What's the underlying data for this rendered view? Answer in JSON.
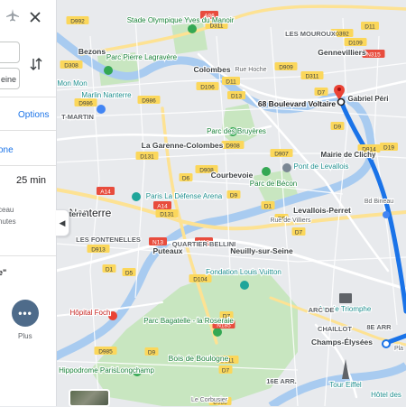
{
  "panel": {
    "origin_value": "",
    "destination_value": "eine",
    "options_label": "Options",
    "mode_label": "one",
    "duration": "25 min",
    "step_line1": "ceau",
    "step_line2": "nutes",
    "quote": "e\"",
    "more_label": "Plus"
  },
  "map": {
    "water": [
      "Seine"
    ],
    "places": [
      {
        "name": "Stade Olympique Yves du Manoir",
        "kind": "poi-green"
      },
      {
        "name": "Bezons",
        "kind": "city"
      },
      {
        "name": "Parc Pierre Lagravère",
        "kind": "poi-green"
      },
      {
        "name": "Colombes",
        "kind": "city"
      },
      {
        "name": "Rue Hoche",
        "kind": "street"
      },
      {
        "name": "LES MOUROUX",
        "kind": "district"
      },
      {
        "name": "Gennevilliers",
        "kind": "city"
      },
      {
        "name": "Gabriel Péri",
        "kind": "transit"
      },
      {
        "name": "68 Boulevard Voltaire",
        "kind": "pin"
      },
      {
        "name": "Nanterre",
        "kind": "city-large"
      },
      {
        "name": "Parc des Bruyères",
        "kind": "poi-green"
      },
      {
        "name": "La Garenne-Colombes",
        "kind": "city"
      },
      {
        "name": "Courbevoie",
        "kind": "city"
      },
      {
        "name": "Parc de Bécon",
        "kind": "poi-green"
      },
      {
        "name": "Pont de Levallois",
        "kind": "poi"
      },
      {
        "name": "Levallois-Perret",
        "kind": "city"
      },
      {
        "name": "Mairie de Clichy",
        "kind": "transit"
      },
      {
        "name": "Paris La Défense Arena",
        "kind": "poi"
      },
      {
        "name": "Nanterre",
        "kind": "city"
      },
      {
        "name": "LES FONTENELLES",
        "kind": "district"
      },
      {
        "name": "QUARTIER BELLINI",
        "kind": "district"
      },
      {
        "name": "Puteaux",
        "kind": "city"
      },
      {
        "name": "Neuilly-sur-Seine",
        "kind": "city"
      },
      {
        "name": "Fondation Louis Vuitton",
        "kind": "poi"
      },
      {
        "name": "Hôpital Foch",
        "kind": "poi-red"
      },
      {
        "name": "Parc Bagatelle - la Roseraie",
        "kind": "poi-green"
      },
      {
        "name": "Bois de Boulogne",
        "kind": "park"
      },
      {
        "name": "Arc de Triomphe",
        "kind": "poi"
      },
      {
        "name": "CHAILLOT",
        "kind": "district"
      },
      {
        "name": "Champs-Élysées",
        "kind": "city"
      },
      {
        "name": "Hippodrome ParisLongchamp",
        "kind": "poi-green"
      },
      {
        "name": "16E ARR.",
        "kind": "district"
      },
      {
        "name": "Tour Eiffel",
        "kind": "poi"
      },
      {
        "name": "Hôtel des",
        "kind": "poi"
      },
      {
        "name": "Le Corbusier",
        "kind": "street"
      },
      {
        "name": "Rue de Villiers",
        "kind": "street"
      },
      {
        "name": "Bd Bineau",
        "kind": "street"
      },
      {
        "name": "8E ARR",
        "kind": "district"
      },
      {
        "name": "Pla",
        "kind": "street"
      },
      {
        "name": "Mon Mon",
        "kind": "poi"
      },
      {
        "name": "Marlin Nanterre",
        "kind": "poi"
      },
      {
        "name": "T-MARTIN",
        "kind": "district"
      },
      {
        "name": "ARC DE",
        "kind": "district"
      }
    ],
    "road_labels": [
      "D992",
      "D11",
      "A86",
      "D311",
      "D109",
      "D392",
      "N315",
      "D308",
      "D311",
      "D909",
      "D11",
      "D986",
      "D7",
      "D106",
      "D13",
      "D986",
      "D9",
      "D908",
      "D914",
      "D131",
      "D907",
      "D6",
      "D908",
      "D9",
      "D9",
      "D7",
      "D19",
      "D1",
      "A14",
      "A14",
      "D131",
      "N13",
      "D913",
      "N13",
      "D1",
      "D5",
      "D104",
      "D7",
      "D985",
      "D9",
      "D911",
      "D7",
      "N185",
      "D985"
    ],
    "route_color": "#1a73e8",
    "pin_color": "#ea4335"
  }
}
